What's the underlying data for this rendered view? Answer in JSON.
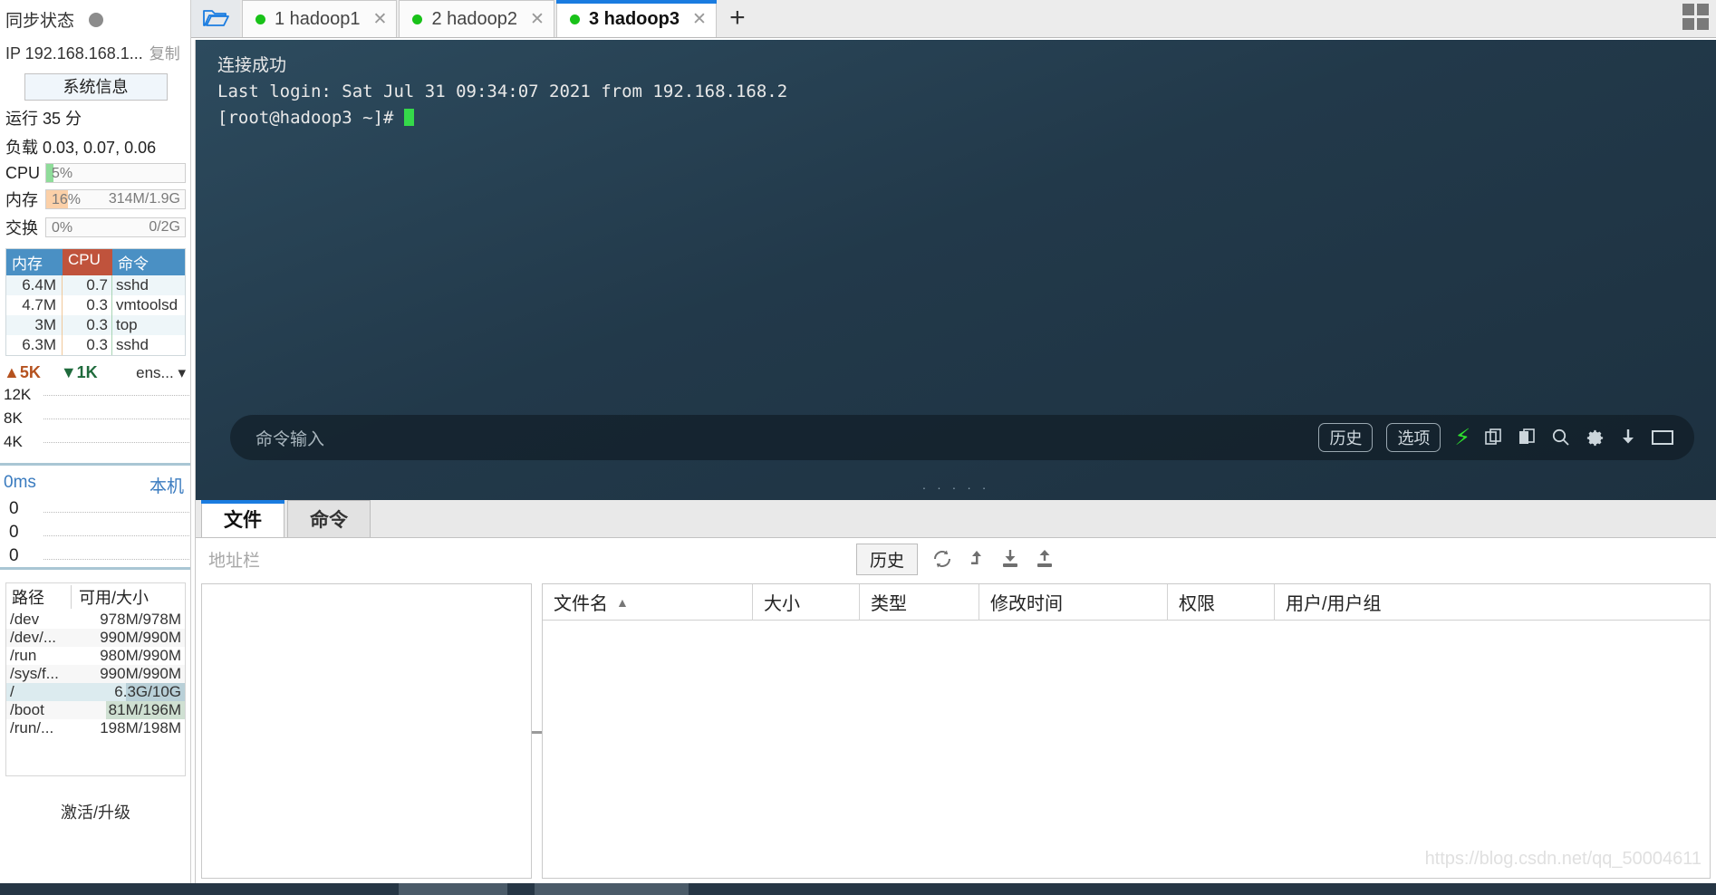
{
  "sidebar": {
    "sync_label": "同步状态",
    "sync_status_icon": "gray-dot",
    "ip_text": "IP 192.168.168.1...",
    "copy_label": "复制",
    "sysinfo_button": "系统信息",
    "uptime": "运行 35 分",
    "load": "负载 0.03, 0.07, 0.06",
    "meters": [
      {
        "label": "CPU",
        "percent": "5%",
        "right": "",
        "fill_pct": 5,
        "color": "#8fdc9a"
      },
      {
        "label": "内存",
        "percent": "16%",
        "right": "314M/1.9G",
        "fill_pct": 16,
        "color": "#fbd0a8"
      },
      {
        "label": "交换",
        "percent": "0%",
        "right": "0/2G",
        "fill_pct": 0,
        "color": "#cfe6f5"
      }
    ],
    "process_table": {
      "headers": [
        "内存",
        "CPU",
        "命令"
      ],
      "rows": [
        {
          "mem": "6.4M",
          "cpu": "0.7",
          "cmd": "sshd"
        },
        {
          "mem": "4.7M",
          "cpu": "0.3",
          "cmd": "vmtoolsd"
        },
        {
          "mem": "3M",
          "cpu": "0.3",
          "cmd": "top"
        },
        {
          "mem": "6.3M",
          "cpu": "0.3",
          "cmd": "sshd"
        }
      ]
    },
    "network": {
      "upload": "5K",
      "download": "1K",
      "interface": "ens...",
      "y_labels": [
        "12K",
        "8K",
        "4K"
      ]
    },
    "ping": {
      "value": "0ms",
      "host": "本机",
      "y_labels": [
        "0",
        "0",
        "0"
      ]
    },
    "disk_table": {
      "headers": [
        "路径",
        "可用/大小"
      ],
      "rows": [
        {
          "path": "/dev",
          "size": "978M/978M",
          "hl_pct": 0,
          "selected": false
        },
        {
          "path": "/dev/...",
          "size": "990M/990M",
          "hl_pct": 0,
          "selected": false
        },
        {
          "path": "/run",
          "size": "980M/990M",
          "hl_pct": 0,
          "selected": false
        },
        {
          "path": "/sys/f...",
          "size": "990M/990M",
          "hl_pct": 0,
          "selected": false
        },
        {
          "path": "/",
          "size": "6.3G/10G",
          "hl_pct": 52,
          "selected": true
        },
        {
          "path": "/boot",
          "size": "81M/196M",
          "hl_pct": 70,
          "selected": false
        },
        {
          "path": "/run/...",
          "size": "198M/198M",
          "hl_pct": 0,
          "selected": false
        }
      ]
    },
    "activate_label": "激活/升级"
  },
  "tabbar": {
    "folder_icon": "open-folder-icon",
    "tabs": [
      {
        "label": "1 hadoop1",
        "active": false,
        "status": "connected"
      },
      {
        "label": "2 hadoop2",
        "active": false,
        "status": "connected"
      },
      {
        "label": "3 hadoop3",
        "active": true,
        "status": "connected"
      }
    ],
    "add_label": "+",
    "layout_icon": "grid-layout-icon"
  },
  "terminal": {
    "line1": "连接成功",
    "line2": "Last login: Sat Jul 31 09:34:07 2021 from 192.168.168.2",
    "line3": "[root@hadoop3 ~]# ",
    "command_input_placeholder": "命令输入",
    "history_button": "历史",
    "options_button": "选项",
    "icons": [
      "bolt-icon",
      "copy-icon",
      "paste-icon",
      "search-icon",
      "gear-icon",
      "download-icon",
      "window-icon"
    ],
    "resize_dots": "· · · · ·"
  },
  "filepanel": {
    "tabs": [
      {
        "label": "文件",
        "active": true
      },
      {
        "label": "命令",
        "active": false
      }
    ],
    "address_placeholder": "地址栏",
    "history_button": "历史",
    "toolbar_icons": [
      "refresh-icon",
      "up-level-icon",
      "download-icon",
      "upload-icon"
    ],
    "columns": [
      "文件名",
      "大小",
      "类型",
      "修改时间",
      "权限",
      "用户/用户组"
    ],
    "sort_indicator": "▲",
    "rows": []
  },
  "watermark": "https://blog.csdn.net/qq_50004611",
  "colors": {
    "accent": "#1a7ce0",
    "terminal_bg": "#22394a",
    "header_blue": "#4a90c4",
    "header_red": "#c0533c",
    "status_green": "#19c219",
    "cursor_green": "#35d94a"
  }
}
